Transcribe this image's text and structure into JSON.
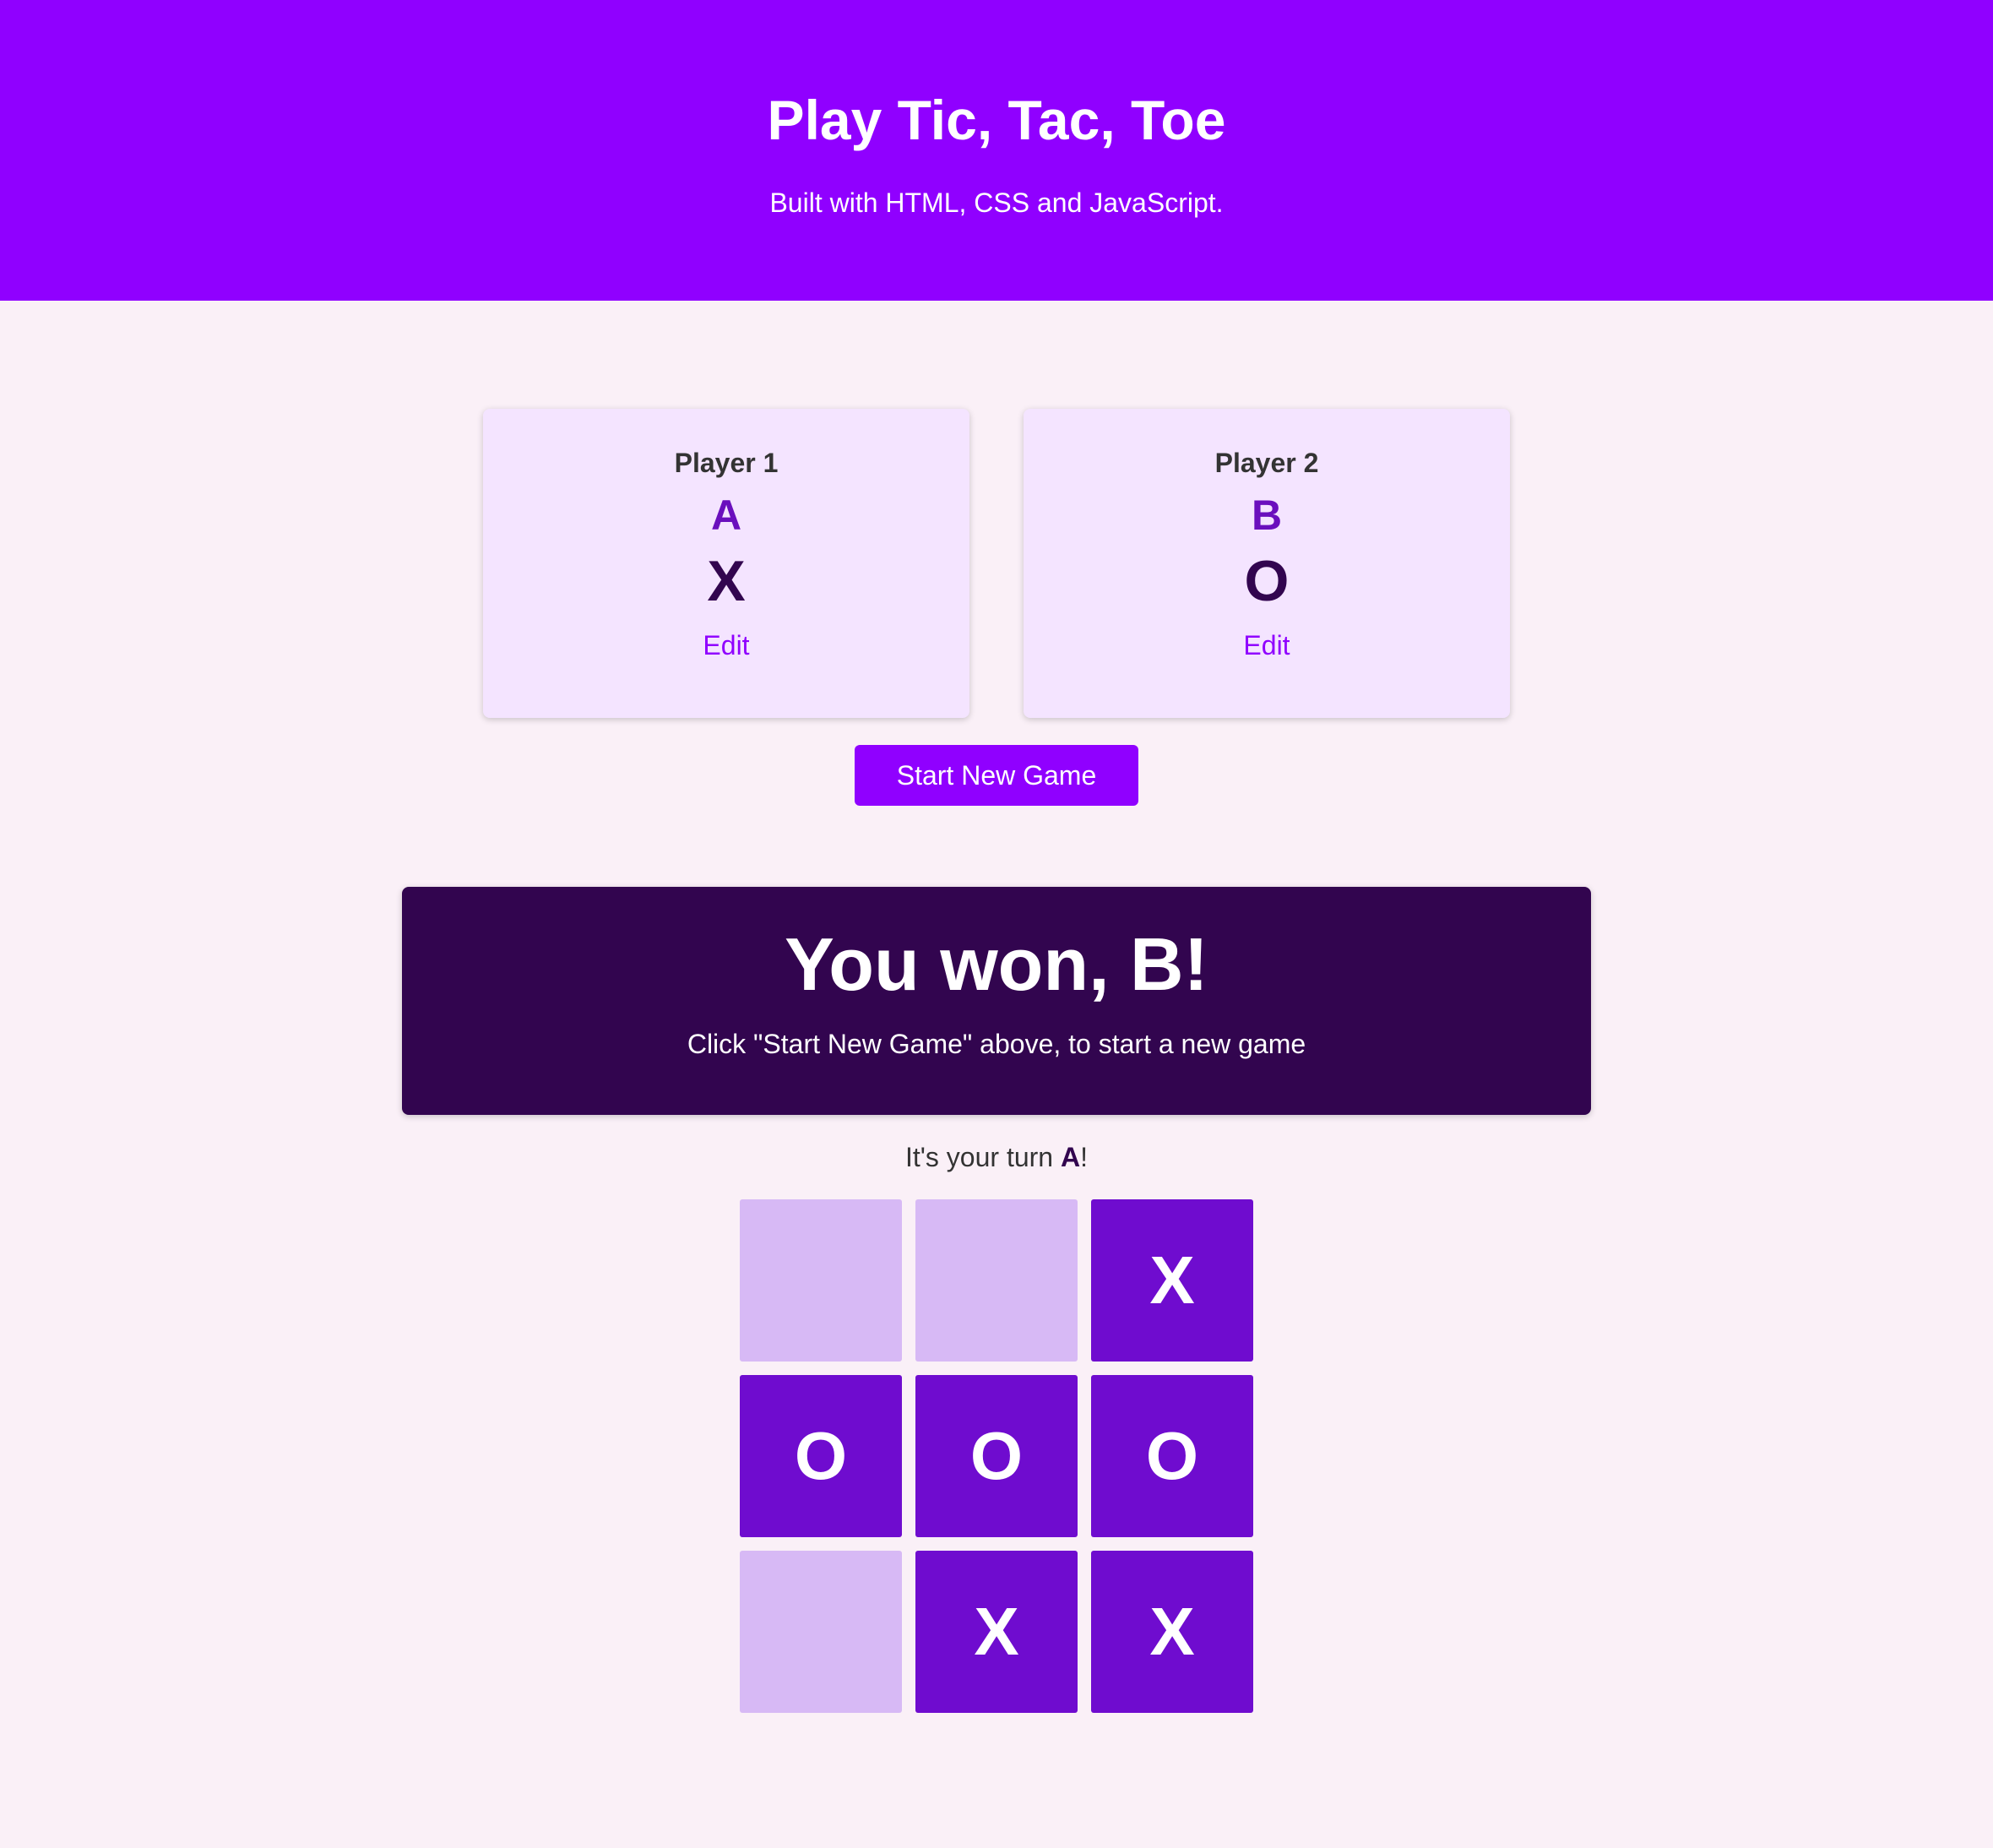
{
  "header": {
    "title": "Play Tic, Tac, Toe",
    "subtitle": "Built with HTML, CSS and JavaScript."
  },
  "players": [
    {
      "label": "Player 1",
      "name": "A",
      "symbol": "X",
      "edit_label": "Edit"
    },
    {
      "label": "Player 2",
      "name": "B",
      "symbol": "O",
      "edit_label": "Edit"
    }
  ],
  "start_button_label": "Start New Game",
  "game_over": {
    "title": "You won, B!",
    "message": "Click \"Start New Game\" above, to start a new game"
  },
  "turn": {
    "prefix": "It's your turn ",
    "player": "A",
    "suffix": "!"
  },
  "board": [
    [
      "",
      "",
      "X"
    ],
    [
      "O",
      "O",
      "O"
    ],
    [
      "",
      "X",
      "X"
    ]
  ],
  "colors": {
    "header_bg": "#9000ff",
    "page_bg": "#faf0f7",
    "card_bg": "#f4e4ff",
    "game_over_bg": "#32054f",
    "cell_empty": "#d7b9f5",
    "cell_filled": "#6f0ccf"
  }
}
